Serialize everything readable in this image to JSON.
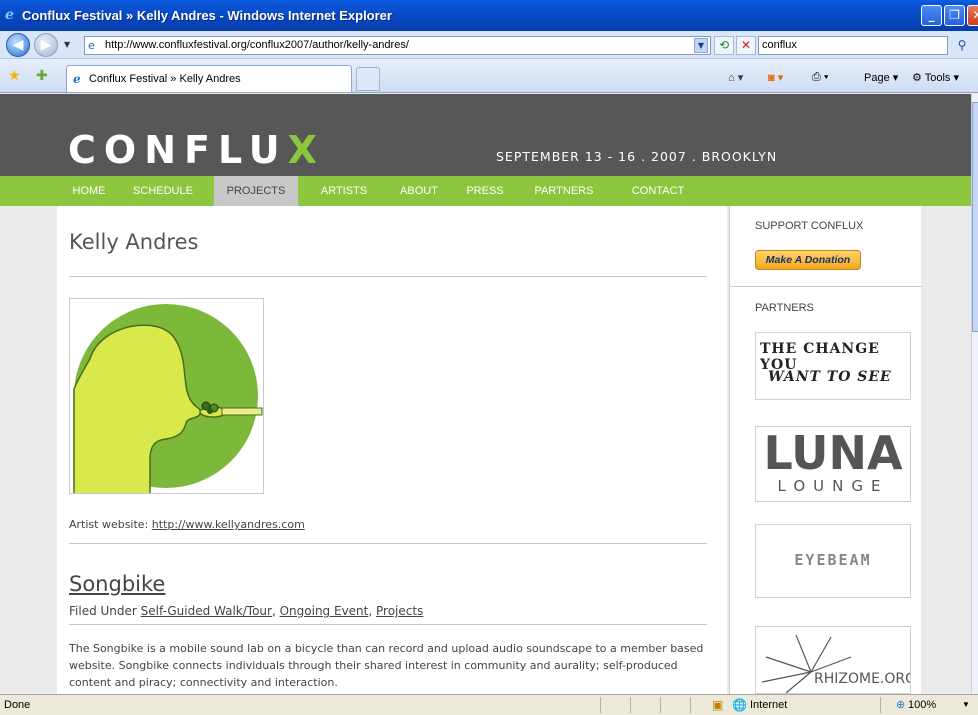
{
  "window": {
    "title": "Conflux Festival » Kelly Andres - Windows Internet Explorer"
  },
  "browser": {
    "url": "http://www.confluxfestival.org/conflux2007/author/kelly-andres/",
    "search_value": "conflux",
    "tab_label": "Conflux Festival » Kelly Andres",
    "cmd_page": "Page",
    "cmd_tools": "Tools"
  },
  "site": {
    "logo": "CONFLU",
    "logo_x": "X",
    "tagline": "SEPTEMBER 13 - 16 . 2007 . BROOKLYN",
    "accent": "#8cc63e",
    "nav": [
      {
        "label": "HOME"
      },
      {
        "label": "SCHEDULE"
      },
      {
        "label": "PROJECTS"
      },
      {
        "label": "ARTISTS"
      },
      {
        "label": "ABOUT"
      },
      {
        "label": "PRESS"
      },
      {
        "label": "PARTNERS"
      },
      {
        "label": "CONTACT"
      }
    ],
    "active_nav": "PROJECTS"
  },
  "main": {
    "artist_name": "Kelly Andres",
    "website_prefix": "Artist website:",
    "website_link": "http://www.kellyandres.com",
    "post": {
      "title": "Songbike",
      "filed_prefix": "Filed Under",
      "categories": [
        "Self-Guided Walk/Tour",
        "Ongoing Event",
        "Projects"
      ],
      "excerpt": "The Songbike is a mobile sound lab on a bicycle than can record and upload audio soundscape to a member based website. Songbike connects individuals through their shared interest in community and aurality; self-produced content and piracy; connectivity and interaction."
    }
  },
  "sidebar": {
    "support_heading": "SUPPORT CONFLUX",
    "donate_label": "Make A Donation",
    "partners_heading": "PARTNERS",
    "partner1_line1": "THE CHANGE YOU",
    "partner1_line2": "WANT TO SEE",
    "partner2_line1": "LUNA",
    "partner2_line2": "LOUNGE",
    "partner3": "EYEBEAM",
    "partner4": "RHIZOME.ORG"
  },
  "status": {
    "text": "Done",
    "zone": "Internet",
    "zoom": "100%"
  }
}
